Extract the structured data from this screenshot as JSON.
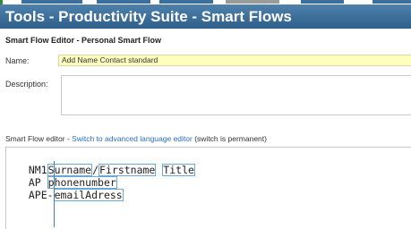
{
  "header": {
    "title": "Tools - Productivity Suite - Smart Flows"
  },
  "editor": {
    "section_title": "Smart Flow Editor - Personal Smart Flow",
    "name_label": "Name:",
    "name_value": "Add Name Contact standard",
    "description_label": "Description:",
    "description_value": ""
  },
  "flow_editor": {
    "label_prefix": "Smart Flow editor - ",
    "switch_link": "Switch to advanced language editor",
    "label_suffix": " (switch is permanent)",
    "lines": [
      {
        "prefix": "NM1",
        "tokens": [
          "Surname",
          "/",
          "Firstname",
          " ",
          "Title"
        ]
      },
      {
        "prefix": "AP ",
        "tokens": [
          "phonenumber"
        ]
      },
      {
        "prefix": "APE-",
        "tokens": [
          "emailAdress"
        ]
      }
    ]
  }
}
